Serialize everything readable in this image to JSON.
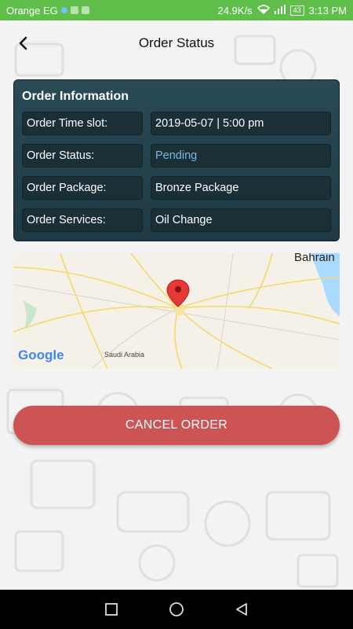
{
  "status_bar": {
    "carrier": "Orange EG",
    "speed": "24.9K/s",
    "battery": "43",
    "time": "3:13 PM"
  },
  "header": {
    "title": "Order Status"
  },
  "order_info": {
    "title": "Order Information",
    "rows": [
      {
        "label": "Order Time slot:",
        "value": "2019-05-07 | 5:00 pm"
      },
      {
        "label": "Order Status:",
        "value": "Pending"
      },
      {
        "label": "Order Package:",
        "value": "Bronze Package"
      },
      {
        "label": "Order Services:",
        "value": "Oil Change"
      }
    ],
    "status_color": "#7fb4e6"
  },
  "map": {
    "place_label_top": "Bahrain",
    "place_label_country": "Saudi Arabia",
    "provider": "Google",
    "marker_color": "#e53935"
  },
  "actions": {
    "cancel_label": "CANCEL ORDER",
    "cancel_color": "#cc5454"
  },
  "colors": {
    "status_bar": "#5fbf4a",
    "card_bg": "#2a4a57"
  }
}
